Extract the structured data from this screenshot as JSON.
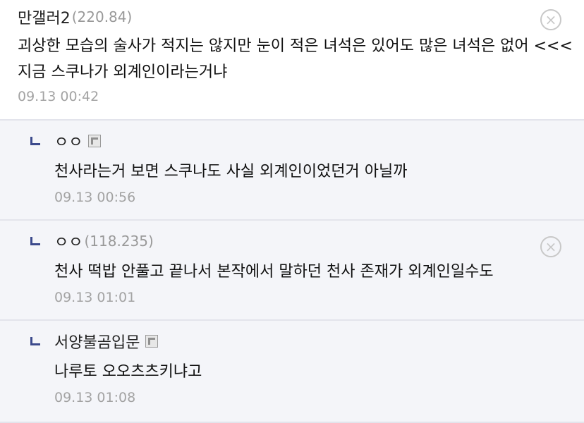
{
  "comments": [
    {
      "nick": "만갤러2",
      "ip": "(220.84)",
      "text": "괴상한 모습의 술사가 적지는 않지만 눈이 적은 녀석은 있어도 많은 녀석은 없어 <<< 지금 스쿠나가 외계인이라는거냐",
      "date": "09.13 00:42",
      "delete_icon": "×"
    },
    {
      "nick": "ㅇㅇ",
      "ip": "",
      "text": "천사라는거 보면 스쿠나도 사실 외계인이었던거 아닐까",
      "date": "09.13 00:56"
    },
    {
      "nick": "ㅇㅇ",
      "ip": "(118.235)",
      "text": "천사 떡밥 안풀고 끝나서 본작에서 말하던 천사 존재가 외계인일수도",
      "date": "09.13 01:01",
      "delete_icon": "×"
    },
    {
      "nick": "서양불곰입문",
      "ip": "",
      "text": "나루토 오오츠츠키냐고",
      "date": "09.13 01:08"
    }
  ]
}
